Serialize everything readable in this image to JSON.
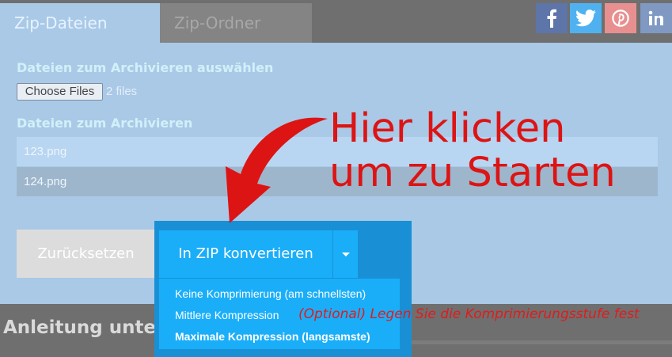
{
  "tabs": [
    {
      "label": "Zip-Dateien Online"
    },
    {
      "label": "Zip-Ordner Online"
    }
  ],
  "social": [
    {
      "icon": "facebook-icon",
      "color": "#3b5998"
    },
    {
      "icon": "twitter-icon",
      "color": "#1da1f2"
    },
    {
      "icon": "pinterest-icon",
      "color": "#e02020"
    },
    {
      "icon": "linkedin-icon",
      "color": "#0a66c2"
    }
  ],
  "form": {
    "select_label": "Dateien zum Archivieren auswählen",
    "choose_button": "Choose Files",
    "file_count": "2 files",
    "list_label": "Dateien zum Archivieren",
    "files": [
      "123.png",
      "124.png"
    ],
    "reset_label": "Zurücksetzen",
    "convert_label": "In ZIP konvertieren"
  },
  "compression_menu": [
    {
      "label": "Keine Komprimierung (am schnellsten)"
    },
    {
      "label": "Mittlere Kompression"
    },
    {
      "label": "Maximale Kompression (langsamste)"
    }
  ],
  "guide_heading": "Anleitung unten",
  "annotations": {
    "start_line1": "Hier klicken",
    "start_line2": "um zu Starten",
    "optional_hint": "(Optional) Legen Sie die Komprimierungsstufe fest",
    "color": "#dd1414"
  },
  "colors": {
    "accent": "#1aaef9",
    "panel": "#a9c9e7"
  }
}
